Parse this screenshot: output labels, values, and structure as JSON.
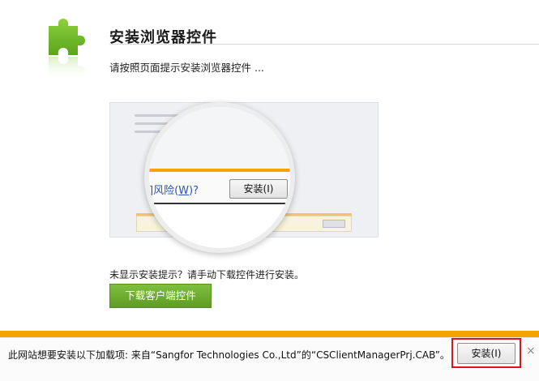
{
  "header": {
    "title": "安装浏览器控件",
    "hint": "请按照页面提示安装浏览器控件 ..."
  },
  "illustration": {
    "link_text": "]风险(",
    "link_accel": "W",
    "link_tail": ")?",
    "button_label": "安装(I)"
  },
  "manual": {
    "notice": "未显示安装提示？请手动下载控件进行安装。",
    "download_label": "下载客户端控件"
  },
  "infobar": {
    "message": "此网站想要安装以下加载项: 来自“Sangfor Technologies Co.,Ltd”的“CSClientManagerPrj.CAB”。",
    "install_label": "安装(I)",
    "close_glyph": "×"
  },
  "colors": {
    "accent_green": "#6aac2f",
    "infobar_orange": "#f5a300",
    "highlight_red": "#d6181c"
  },
  "icons": [
    "puzzle-icon",
    "close-icon"
  ]
}
